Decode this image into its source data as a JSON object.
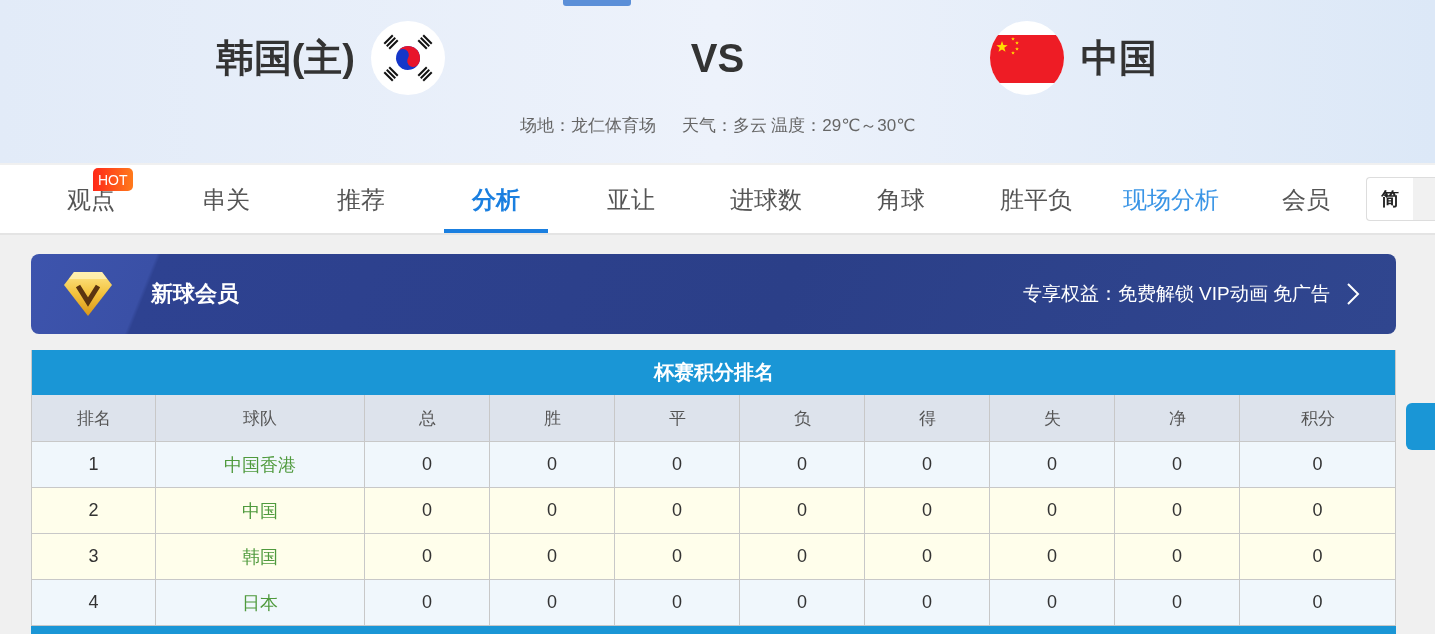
{
  "header": {
    "home_team": {
      "name": "韩国(主)"
    },
    "versus": "VS",
    "away_team": {
      "name": "中国"
    },
    "venue": "场地：龙仁体育场",
    "weather": "天气：多云 温度：29℃～30℃"
  },
  "nav": {
    "tabs": [
      {
        "label": "观点",
        "selected": false,
        "highlighted": false,
        "badge": "HOT"
      },
      {
        "label": "串关",
        "selected": false,
        "highlighted": false
      },
      {
        "label": "推荐",
        "selected": false,
        "highlighted": false
      },
      {
        "label": "分析",
        "selected": true,
        "highlighted": false
      },
      {
        "label": "亚让",
        "selected": false,
        "highlighted": false
      },
      {
        "label": "进球数",
        "selected": false,
        "highlighted": false
      },
      {
        "label": "角球",
        "selected": false,
        "highlighted": false
      },
      {
        "label": "胜平负",
        "selected": false,
        "highlighted": false
      },
      {
        "label": "现场分析",
        "selected": false,
        "highlighted": true
      },
      {
        "label": "会员",
        "selected": false,
        "highlighted": false
      }
    ],
    "language_toggle": {
      "options": [
        {
          "label": "简",
          "selected": true
        }
      ]
    }
  },
  "vip_banner": {
    "title": "新球会员",
    "benefits": "专享权益：免费解锁 VIP动画 免广告"
  },
  "standings": {
    "title": "杯赛积分排名",
    "columns": [
      "排名",
      "球队",
      "总",
      "胜",
      "平",
      "负",
      "得",
      "失",
      "净",
      "积分"
    ],
    "rows": [
      {
        "rank": "1",
        "team": "中国香港",
        "stats": [
          "0",
          "0",
          "0",
          "0",
          "0",
          "0",
          "0",
          "0"
        ],
        "highlighted": false
      },
      {
        "rank": "2",
        "team": "中国",
        "stats": [
          "0",
          "0",
          "0",
          "0",
          "0",
          "0",
          "0",
          "0"
        ],
        "highlighted": true
      },
      {
        "rank": "3",
        "team": "韩国",
        "stats": [
          "0",
          "0",
          "0",
          "0",
          "0",
          "0",
          "0",
          "0"
        ],
        "highlighted": true
      },
      {
        "rank": "4",
        "team": "日本",
        "stats": [
          "0",
          "0",
          "0",
          "0",
          "0",
          "0",
          "0",
          "0"
        ],
        "highlighted": false
      }
    ]
  }
}
